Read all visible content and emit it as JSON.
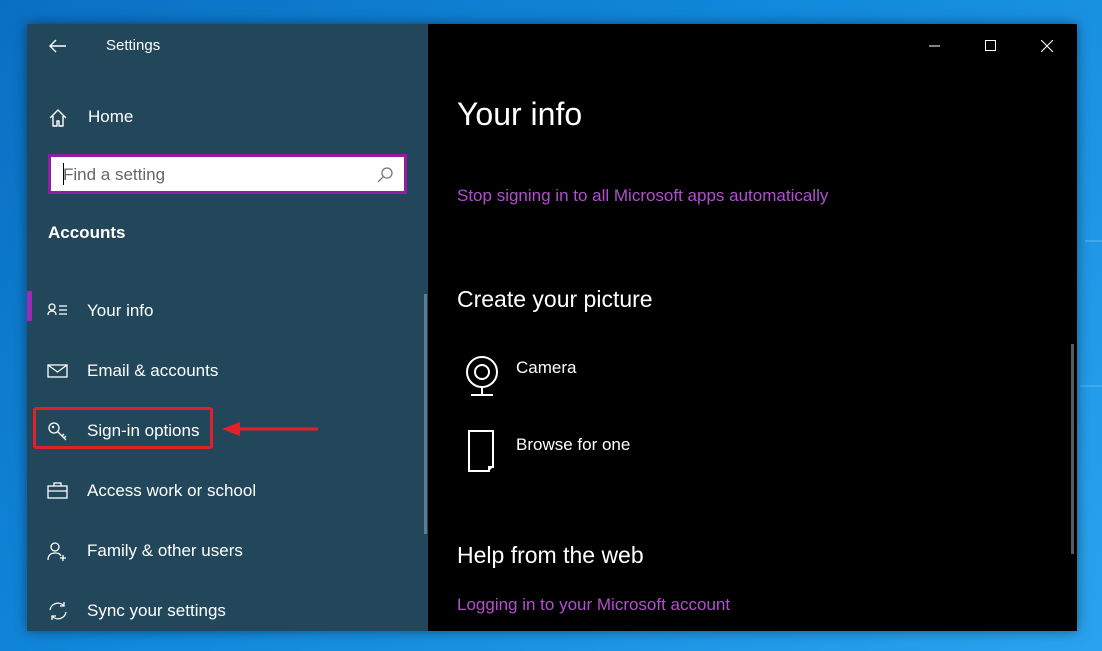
{
  "window": {
    "title": "Settings",
    "controls": [
      "minimize",
      "maximize",
      "close"
    ]
  },
  "sidebar": {
    "home_label": "Home",
    "search": {
      "placeholder": "Find a setting"
    },
    "section_title": "Accounts",
    "items": [
      {
        "label": "Your info",
        "icon": "person-card-icon",
        "active": true
      },
      {
        "label": "Email & accounts",
        "icon": "mail-icon"
      },
      {
        "label": "Sign-in options",
        "icon": "key-icon",
        "highlighted": true
      },
      {
        "label": "Access work or school",
        "icon": "briefcase-icon"
      },
      {
        "label": "Family & other users",
        "icon": "person-add-icon"
      },
      {
        "label": "Sync your settings",
        "icon": "sync-icon"
      }
    ]
  },
  "main": {
    "title": "Your info",
    "stop_link": "Stop signing in to all Microsoft apps automatically",
    "picture_heading": "Create your picture",
    "picture_options": [
      {
        "label": "Camera",
        "icon": "webcam-icon"
      },
      {
        "label": "Browse for one",
        "icon": "file-icon"
      }
    ],
    "help_heading": "Help from the web",
    "help_link": "Logging in to your Microsoft account"
  },
  "colors": {
    "sidebar_bg": "#22475a",
    "main_bg": "#000000",
    "accent": "#9b2ab5",
    "link": "#b24fcf",
    "annotation": "#e0202a",
    "desktop": "#1189dc"
  }
}
